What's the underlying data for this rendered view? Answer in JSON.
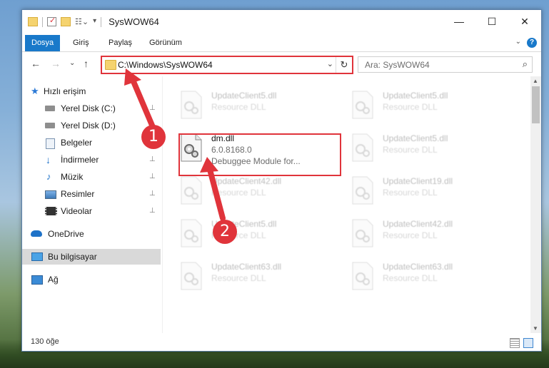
{
  "window": {
    "title": "SysWOW64",
    "minimize": "—",
    "maximize": "☐",
    "close": "✕"
  },
  "ribbon": {
    "tabs": [
      "Dosya",
      "Giriş",
      "Paylaş",
      "Görünüm"
    ],
    "chevron": "⌄",
    "help": "?"
  },
  "nav": {
    "back": "←",
    "forward": "→",
    "recent": "⌄",
    "up": "↑"
  },
  "address": {
    "path": "C:\\Windows\\SysWOW64",
    "dropdown": "⌄",
    "refresh": "↻"
  },
  "search": {
    "placeholder": "Ara: SysWOW64",
    "icon": "⌕"
  },
  "sidebar": {
    "items": [
      {
        "label": "Hızlı erişim",
        "icon": "star-icon",
        "pinned": false
      },
      {
        "label": "Yerel Disk (C:)",
        "icon": "drive-icon",
        "pinned": true
      },
      {
        "label": "Yerel Disk (D:)",
        "icon": "drive-icon",
        "pinned": true
      },
      {
        "label": "Belgeler",
        "icon": "documents-icon",
        "pinned": true
      },
      {
        "label": "İndirmeler",
        "icon": "downloads-icon",
        "pinned": true
      },
      {
        "label": "Müzik",
        "icon": "music-icon",
        "pinned": true
      },
      {
        "label": "Resimler",
        "icon": "pictures-icon",
        "pinned": true
      },
      {
        "label": "Videolar",
        "icon": "videos-icon",
        "pinned": true
      },
      {
        "label": "OneDrive",
        "icon": "cloud-icon",
        "pinned": false
      },
      {
        "label": "Bu bilgisayar",
        "icon": "computer-icon",
        "pinned": false,
        "selected": true
      },
      {
        "label": "Ağ",
        "icon": "network-icon",
        "pinned": false
      }
    ],
    "pin_glyph": "📌"
  },
  "files": [
    {
      "name": "UpdateClient5.dll",
      "sub": "Resource DLL",
      "faded": true
    },
    {
      "name": "UpdateClient5.dll",
      "sub": "Resource DLL",
      "faded": true
    },
    {
      "name": "dm.dll",
      "sub": "6.0.8168.0",
      "sub2": "Debuggee Module for...",
      "faded": false
    },
    {
      "name": "UpdateClient5.dll",
      "sub": "Resource DLL",
      "faded": true
    },
    {
      "name": "UpdateClient42.dll",
      "sub": "Resource DLL",
      "faded": true
    },
    {
      "name": "UpdateClient19.dll",
      "sub": "Resource DLL",
      "faded": true
    },
    {
      "name": "UpdateClient5.dll",
      "sub": "Resource DLL",
      "faded": true
    },
    {
      "name": "UpdateClient42.dll",
      "sub": "Resource DLL",
      "faded": true
    },
    {
      "name": "UpdateClient63.dll",
      "sub": "Resource DLL",
      "faded": true
    },
    {
      "name": "UpdateClient63.dll",
      "sub": "Resource DLL",
      "faded": true
    }
  ],
  "status": {
    "count": "130 öğe"
  },
  "annotations": {
    "step1": "1",
    "step2": "2",
    "color": "#e0343b"
  }
}
